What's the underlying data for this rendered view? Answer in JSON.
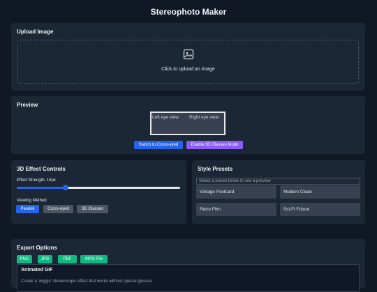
{
  "app": {
    "title": "Stereophoto Maker"
  },
  "upload": {
    "title": "Upload Image",
    "prompt": "Click to upload an image",
    "icon": "image-icon"
  },
  "preview": {
    "title": "Preview",
    "left_alt": "Left eye view",
    "right_alt": "Right eye view",
    "switch_button": "Switch to Cross-eyed",
    "glasses_button": "Enable 3D Glasses Mode"
  },
  "controls": {
    "title": "3D Effect Controls",
    "strength_label": "Effect Strength: 15px",
    "strength_fraction": 0.3,
    "method_label": "Viewing Method",
    "methods": [
      "Parallel",
      "Cross-eyed",
      "3D Glasses"
    ],
    "active_method": "Parallel"
  },
  "presets": {
    "title": "Style Presets",
    "select_placeholder": "Select a preset below to see a preview",
    "items": [
      "Vintage Postcard",
      "Modern Clean",
      "Retro Film",
      "Sci-Fi Future"
    ]
  },
  "export": {
    "title": "Export Options",
    "formats": [
      "PNG",
      "JPG",
      "PDF",
      "MPO File"
    ],
    "gif_title": "Animated GIF",
    "gif_desc": "Create a 'wiggle' stereoscopic effect that works without special glasses"
  },
  "colors": {
    "primary": "#2563eb",
    "accent": "#8b5cf6",
    "export": "#10b981"
  }
}
